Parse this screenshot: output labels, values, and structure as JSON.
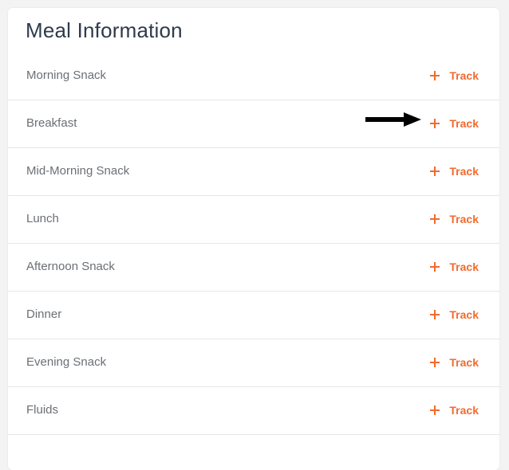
{
  "card": {
    "title": "Meal Information"
  },
  "meals": [
    {
      "name": "Morning Snack",
      "action": "Track"
    },
    {
      "name": "Breakfast",
      "action": "Track"
    },
    {
      "name": "Mid-Morning Snack",
      "action": "Track"
    },
    {
      "name": "Lunch",
      "action": "Track"
    },
    {
      "name": "Afternoon Snack",
      "action": "Track"
    },
    {
      "name": "Dinner",
      "action": "Track"
    },
    {
      "name": "Evening Snack",
      "action": "Track"
    },
    {
      "name": "Fluids",
      "action": "Track"
    },
    {
      "name": "",
      "action": ""
    }
  ],
  "icons": {
    "track": "plus-icon",
    "annotation": "arrow-right-icon"
  },
  "colors": {
    "accent": "#f26a2d",
    "title": "#2f3b4c",
    "text": "#6b6f75",
    "annotation": "#000000"
  }
}
